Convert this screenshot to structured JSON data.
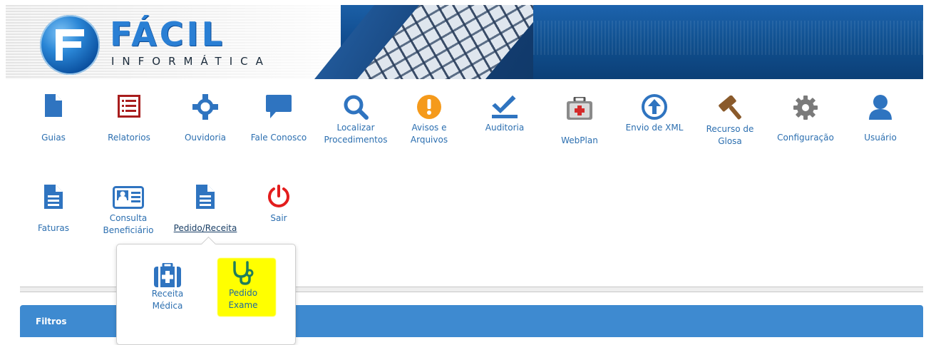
{
  "logo": {
    "name": "FÁCIL",
    "subtitle": "INFORMÁTICA"
  },
  "menu": {
    "row1": [
      {
        "id": "guias",
        "label": "Guias",
        "icon": "document-icon"
      },
      {
        "id": "relatorios",
        "label": "Relatorios",
        "icon": "list-report-icon"
      },
      {
        "id": "ouvidoria",
        "label": "Ouvidoria",
        "icon": "crosshair-icon"
      },
      {
        "id": "fale-conosco",
        "label": "Fale Conosco",
        "icon": "chat-bubble-icon"
      },
      {
        "id": "localizar",
        "label": "Localizar Procedimentos",
        "icon": "search-icon"
      },
      {
        "id": "avisos",
        "label": "Avisos e Arquivos",
        "icon": "warning-icon"
      },
      {
        "id": "auditoria",
        "label": "Auditoria",
        "icon": "checkmark-icon"
      },
      {
        "id": "webplan",
        "label": "WebPlan",
        "icon": "first-aid-kit-icon"
      },
      {
        "id": "envio-xml",
        "label": "Envio de XML",
        "icon": "upload-arrow-icon"
      },
      {
        "id": "recurso-glosa",
        "label": "Recurso de Glosa",
        "icon": "gavel-icon"
      },
      {
        "id": "configuracao",
        "label": "Configuração",
        "icon": "gear-icon"
      },
      {
        "id": "usuario",
        "label": "Usuário",
        "icon": "user-icon"
      }
    ],
    "row2": [
      {
        "id": "faturas",
        "label": "Faturas",
        "icon": "invoice-document-icon"
      },
      {
        "id": "consulta-beneficiario",
        "label": "Consulta Beneficiário",
        "icon": "id-card-icon"
      },
      {
        "id": "pedido-receita",
        "label": "Pedido/Receita",
        "icon": "prescription-document-icon"
      },
      {
        "id": "sair",
        "label": "Sair",
        "icon": "power-icon"
      }
    ]
  },
  "dropdown": {
    "items": [
      {
        "label": "Receita Médica",
        "icon": "medical-case-icon"
      },
      {
        "label": "Pedido Exame",
        "icon": "stethoscope-icon"
      }
    ]
  },
  "filters": {
    "label": "Filtros"
  },
  "colors": {
    "icon_blue": "#2f74c0",
    "red": "#a81d1d",
    "orange": "#f59a1b",
    "brown": "#8a5a2b",
    "gray": "#7a7a7a",
    "power_red": "#e31d1d",
    "bar_blue": "#3e8ad0",
    "highlight": "#ffff00"
  }
}
